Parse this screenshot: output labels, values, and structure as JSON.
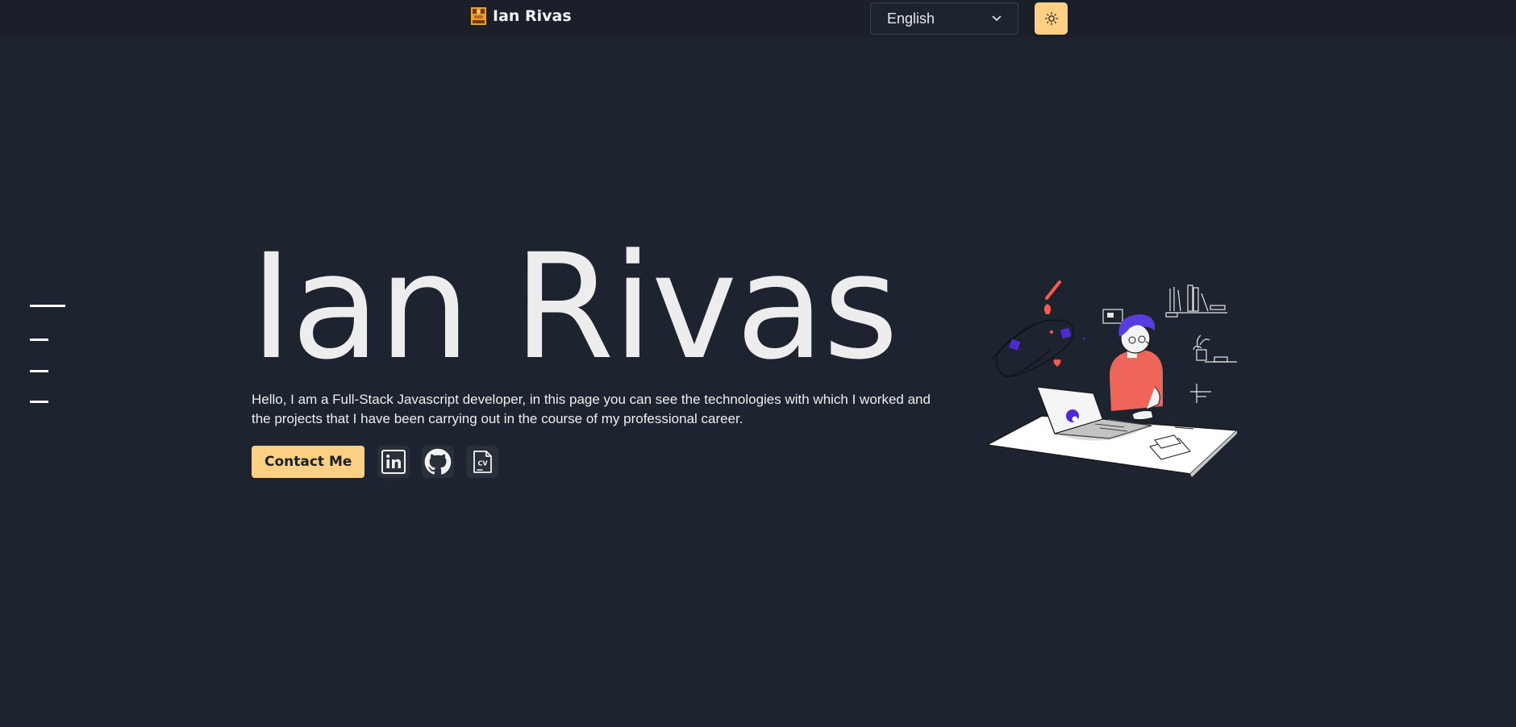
{
  "header": {
    "brand_name": "Ian Rivas",
    "logo_icon": "pixel-logo-icon",
    "language": {
      "selected": "English"
    },
    "theme_toggle_icon": "sun-icon"
  },
  "side_nav": {
    "items": [
      {
        "icon": "nav-line"
      },
      {
        "icon": "nav-line"
      },
      {
        "icon": "nav-line"
      },
      {
        "icon": "nav-line"
      }
    ]
  },
  "hero": {
    "title": "Ian Rivas",
    "description": "Hello, I am a Full-Stack Javascript developer, in this page you can see the technologies with which I worked and the projects that I have been carrying out in the course of my professional career.",
    "contact_label": "Contact Me",
    "social": [
      {
        "icon": "linkedin-icon"
      },
      {
        "icon": "github-icon"
      },
      {
        "icon": "cv-icon",
        "label": "CV"
      }
    ],
    "illustration": "developer-at-desk-illustration"
  },
  "colors": {
    "background": "#1d232f",
    "header_bg": "#1a1f29",
    "accent": "#fdd083",
    "text": "#eeeeee"
  }
}
